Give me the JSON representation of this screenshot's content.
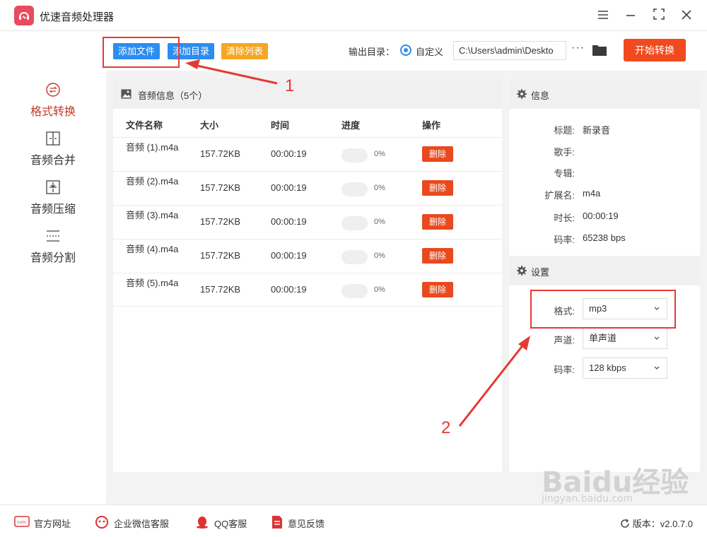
{
  "app": {
    "title": "优速音频处理器",
    "version_label": "版本：",
    "version": "v2.0.7.0"
  },
  "window_controls": [
    "menu-icon",
    "minimize-icon",
    "maximize-icon",
    "close-icon"
  ],
  "sidebar": {
    "items": [
      {
        "label": "格式转换",
        "icon": "convert-icon",
        "active": true
      },
      {
        "label": "音频合并",
        "icon": "merge-icon",
        "active": false
      },
      {
        "label": "音频压缩",
        "icon": "compress-icon",
        "active": false
      },
      {
        "label": "音频分割",
        "icon": "split-icon",
        "active": false
      }
    ]
  },
  "toolbar": {
    "add_file": "添加文件",
    "add_dir": "添加目录",
    "clear_list": "清除列表",
    "output_label": "输出目录：",
    "output_option": "自定义",
    "output_path": "C:\\Users\\admin\\Deskto",
    "more": "···",
    "start": "开始转换"
  },
  "file_list": {
    "title": "音频信息（5个）",
    "columns": [
      "文件名称",
      "大小",
      "时间",
      "进度",
      "操作"
    ],
    "rows": [
      {
        "name": "音频 (1).m4a",
        "size": "157.72KB",
        "time": "00:00:19",
        "progress": "0%",
        "action": "删除"
      },
      {
        "name": "音频 (2).m4a",
        "size": "157.72KB",
        "time": "00:00:19",
        "progress": "0%",
        "action": "删除"
      },
      {
        "name": "音频 (3).m4a",
        "size": "157.72KB",
        "time": "00:00:19",
        "progress": "0%",
        "action": "删除"
      },
      {
        "name": "音频 (4).m4a",
        "size": "157.72KB",
        "time": "00:00:19",
        "progress": "0%",
        "action": "删除"
      },
      {
        "name": "音频 (5).m4a",
        "size": "157.72KB",
        "time": "00:00:19",
        "progress": "0%",
        "action": "删除"
      }
    ]
  },
  "info": {
    "title": "信息",
    "fields": [
      {
        "label": "标题:",
        "value": "新录音"
      },
      {
        "label": "歌手:",
        "value": ""
      },
      {
        "label": "专辑:",
        "value": ""
      },
      {
        "label": "扩展名:",
        "value": "m4a"
      },
      {
        "label": "时长:",
        "value": "00:00:19"
      },
      {
        "label": "码率:",
        "value": "65238 bps"
      }
    ]
  },
  "settings": {
    "title": "设置",
    "fields": [
      {
        "label": "格式:",
        "value": "mp3"
      },
      {
        "label": "声道:",
        "value": "单声道"
      },
      {
        "label": "码率:",
        "value": "128 kbps"
      }
    ]
  },
  "footer": {
    "links": [
      "官方网址",
      "企业微信客服",
      "QQ客服",
      "意见反馈"
    ]
  },
  "annotations": {
    "num1": "1",
    "num2": "2"
  },
  "watermark": {
    "big": "Baidu经验",
    "small": "jingyan.baidu.com"
  },
  "colors": {
    "accent_blue": "#2d8cf0",
    "accent_orange": "#f5a623",
    "start_red": "#f04a1e",
    "active_red": "#c0392b",
    "annotation_red": "#e53935"
  }
}
